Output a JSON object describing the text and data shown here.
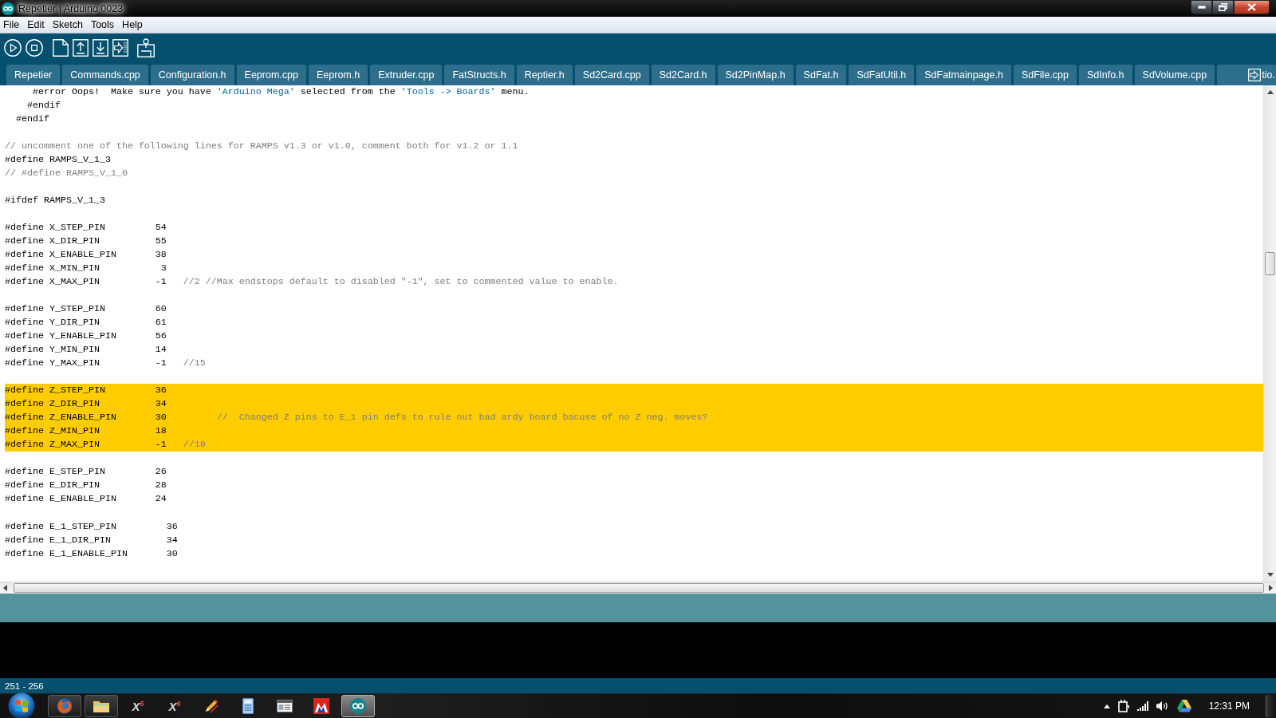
{
  "window": {
    "title": "Repetier | Arduino 0023"
  },
  "menu": [
    "File",
    "Edit",
    "Sketch",
    "Tools",
    "Help"
  ],
  "tabs": [
    {
      "label": "Repetier",
      "selected": false
    },
    {
      "label": "Commands.cpp",
      "selected": false
    },
    {
      "label": "Configuration.h",
      "selected": false
    },
    {
      "label": "Eeprom.cpp",
      "selected": false
    },
    {
      "label": "Eeprom.h",
      "selected": false
    },
    {
      "label": "Extruder.cpp",
      "selected": false
    },
    {
      "label": "FatStructs.h",
      "selected": false
    },
    {
      "label": "Reptier.h",
      "selected": false
    },
    {
      "label": "Sd2Card.cpp",
      "selected": false
    },
    {
      "label": "Sd2Card.h",
      "selected": false
    },
    {
      "label": "Sd2PinMap.h",
      "selected": false
    },
    {
      "label": "SdFat.h",
      "selected": false
    },
    {
      "label": "SdFatUtil.h",
      "selected": false
    },
    {
      "label": "SdFatmainpage.h",
      "selected": false
    },
    {
      "label": "SdFile.cpp",
      "selected": false
    },
    {
      "label": "SdInfo.h",
      "selected": false
    },
    {
      "label": "SdVolume.cpp",
      "selected": false
    },
    {
      "label": "tio.",
      "selected": false
    }
  ],
  "editor": {
    "blocks": [
      [
        {
          "highlighted": false,
          "segments": [
            {
              "kind": "code",
              "text": "     #error Oops!  Make sure you have "
            },
            {
              "kind": "string",
              "text": "'Arduino Mega'"
            },
            {
              "kind": "code",
              "text": " selected from the "
            },
            {
              "kind": "string",
              "text": "'Tools -> Boards'"
            },
            {
              "kind": "code",
              "text": " menu."
            }
          ]
        },
        {
          "highlighted": false,
          "segments": [
            {
              "kind": "code",
              "text": "    #endif"
            }
          ]
        },
        {
          "highlighted": false,
          "segments": [
            {
              "kind": "code",
              "text": "  #endif"
            }
          ]
        }
      ],
      [
        {
          "highlighted": false,
          "segments": [
            {
              "kind": "comment",
              "text": "// uncomment one of the following lines for RAMPS v1.3 or v1.0, comment both for v1.2 or 1.1"
            }
          ]
        },
        {
          "highlighted": false,
          "segments": [
            {
              "kind": "code",
              "text": "#define RAMPS_V_1_3"
            }
          ]
        },
        {
          "highlighted": false,
          "segments": [
            {
              "kind": "comment",
              "text": "// #define RAMPS_V_1_0"
            }
          ]
        }
      ],
      [
        {
          "highlighted": false,
          "segments": [
            {
              "kind": "code",
              "text": "#ifdef RAMPS_V_1_3"
            }
          ]
        }
      ],
      [
        {
          "highlighted": false,
          "segments": [
            {
              "kind": "code",
              "text": "#define X_STEP_PIN         54"
            }
          ]
        },
        {
          "highlighted": false,
          "segments": [
            {
              "kind": "code",
              "text": "#define X_DIR_PIN          55"
            }
          ]
        },
        {
          "highlighted": false,
          "segments": [
            {
              "kind": "code",
              "text": "#define X_ENABLE_PIN       38"
            }
          ]
        },
        {
          "highlighted": false,
          "segments": [
            {
              "kind": "code",
              "text": "#define X_MIN_PIN           3"
            }
          ]
        },
        {
          "highlighted": false,
          "segments": [
            {
              "kind": "code",
              "text": "#define X_MAX_PIN          -1   "
            },
            {
              "kind": "comment",
              "text": "//2 //Max endstops default to disabled \"-1\", set to commented value to enable."
            }
          ]
        }
      ],
      [
        {
          "highlighted": false,
          "segments": [
            {
              "kind": "code",
              "text": "#define Y_STEP_PIN         60"
            }
          ]
        },
        {
          "highlighted": false,
          "segments": [
            {
              "kind": "code",
              "text": "#define Y_DIR_PIN          61"
            }
          ]
        },
        {
          "highlighted": false,
          "segments": [
            {
              "kind": "code",
              "text": "#define Y_ENABLE_PIN       56"
            }
          ]
        },
        {
          "highlighted": false,
          "segments": [
            {
              "kind": "code",
              "text": "#define Y_MIN_PIN          14"
            }
          ]
        },
        {
          "highlighted": false,
          "segments": [
            {
              "kind": "code",
              "text": "#define Y_MAX_PIN          -1   "
            },
            {
              "kind": "comment",
              "text": "//15"
            }
          ]
        }
      ],
      [
        {
          "highlighted": true,
          "segments": [
            {
              "kind": "code",
              "text": "#define Z_STEP_PIN         36"
            }
          ]
        },
        {
          "highlighted": true,
          "segments": [
            {
              "kind": "code",
              "text": "#define Z_DIR_PIN          34"
            }
          ]
        },
        {
          "highlighted": true,
          "segments": [
            {
              "kind": "code",
              "text": "#define Z_ENABLE_PIN       30         "
            },
            {
              "kind": "comment",
              "text": "//  Changed Z pins to E_1 pin defs to rule out bad ardy board bacuse of no Z neg. moves?"
            }
          ]
        },
        {
          "highlighted": true,
          "segments": [
            {
              "kind": "code",
              "text": "#define Z_MIN_PIN          18"
            }
          ]
        },
        {
          "highlighted": true,
          "segments": [
            {
              "kind": "code",
              "text": "#define Z_MAX_PIN          -1   "
            },
            {
              "kind": "comment",
              "text": "//19"
            }
          ]
        }
      ],
      [
        {
          "highlighted": false,
          "segments": [
            {
              "kind": "code",
              "text": "#define E_STEP_PIN         26"
            }
          ]
        },
        {
          "highlighted": false,
          "segments": [
            {
              "kind": "code",
              "text": "#define E_DIR_PIN          28"
            }
          ]
        },
        {
          "highlighted": false,
          "segments": [
            {
              "kind": "code",
              "text": "#define E_ENABLE_PIN       24"
            }
          ]
        }
      ],
      [
        {
          "highlighted": false,
          "segments": [
            {
              "kind": "code",
              "text": "#define E_1_STEP_PIN         36"
            }
          ]
        },
        {
          "highlighted": false,
          "segments": [
            {
              "kind": "code",
              "text": "#define E_1_DIR_PIN          34"
            }
          ]
        },
        {
          "highlighted": false,
          "segments": [
            {
              "kind": "code",
              "text": "#define E_1_ENABLE_PIN       30"
            }
          ]
        }
      ]
    ]
  },
  "status_bar": {
    "text": "251 - 256"
  },
  "taskbar": {
    "apps": [
      {
        "kind": "icon",
        "open": true,
        "active": false
      },
      {
        "kind": "icon",
        "open": true,
        "active": false
      },
      {
        "kind": "text",
        "label": "X$^{5}$",
        "open": false,
        "active": false
      },
      {
        "kind": "text",
        "label": "X$^{6}$",
        "open": false,
        "active": false
      },
      {
        "kind": "icon",
        "open": false,
        "active": false
      },
      {
        "kind": "icon",
        "open": false,
        "active": false
      },
      {
        "kind": "icon",
        "open": false,
        "active": false
      },
      {
        "kind": "icon",
        "open": false,
        "active": false
      },
      {
        "kind": "icon",
        "open": true,
        "active": true
      }
    ],
    "clock": "12:31 PM"
  }
}
